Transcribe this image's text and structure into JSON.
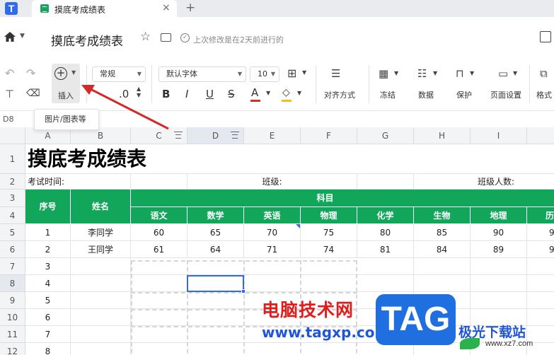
{
  "tabbar": {
    "tab_title": "摸底考成绩表",
    "close": "×",
    "new_tab": "+"
  },
  "titlebar": {
    "doc_title": "摸底考成绩表",
    "save_status": "上次修改是在2天前进行的"
  },
  "toolbar": {
    "insert_label": "插入",
    "number_format": "常规",
    "font_name": "默认字体",
    "font_size": "10",
    "decimal": ".0",
    "align_label": "对齐方式",
    "freeze_label": "冻结",
    "data_label": "数据",
    "protect_label": "保护",
    "page_setup_label": "页面设置",
    "format_label": "格式",
    "font_color": "#d93025",
    "fill_color": "#f4c20d"
  },
  "tooltip": "图片/图表等",
  "formula_bar": {
    "cell_ref": "D8"
  },
  "columns": [
    "A",
    "B",
    "C",
    "D",
    "E",
    "F",
    "G",
    "H",
    "I",
    ""
  ],
  "rows": [
    "1",
    "2",
    "3",
    "4",
    "5",
    "6",
    "7",
    "8",
    "9",
    "10",
    "11",
    "12"
  ],
  "sheet": {
    "title": "摸底考成绩表",
    "exam_time": "考试时间:",
    "class": "班级:",
    "class_size": "班级人数:",
    "h_seq": "序号",
    "h_name": "姓名",
    "h_subjects": "科目",
    "subjects": [
      "语文",
      "数学",
      "英语",
      "物理",
      "化学",
      "生物",
      "地理",
      "历"
    ],
    "students": [
      {
        "seq": "1",
        "name": "李同学",
        "scores": [
          "60",
          "65",
          "70",
          "75",
          "80",
          "85",
          "90",
          "9"
        ]
      },
      {
        "seq": "2",
        "name": "王同学",
        "scores": [
          "61",
          "64",
          "71",
          "74",
          "81",
          "84",
          "89",
          "9"
        ]
      }
    ],
    "seq_more": [
      "3",
      "4",
      "5",
      "6",
      "7",
      "8"
    ]
  },
  "watermark": {
    "text": "电脑技术网",
    "url": "www.tagxp.com",
    "tag": "TAG",
    "site": "极光下载站",
    "site_url": "www.xz7.com"
  }
}
